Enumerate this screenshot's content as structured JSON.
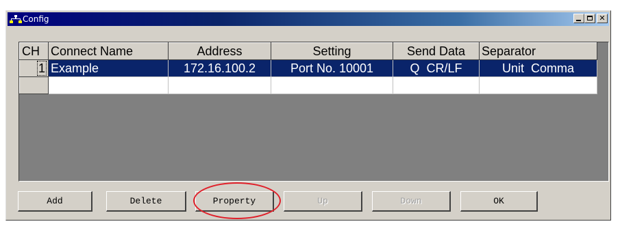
{
  "window": {
    "title": "Config",
    "icon": "network-icon",
    "controls": [
      "minimize-icon",
      "maximize-icon",
      "close-icon"
    ]
  },
  "table": {
    "columns": [
      "CH",
      "Connect Name",
      "Address",
      "Setting",
      "Send Data",
      "Separator"
    ],
    "rows": [
      {
        "ch": "1",
        "connect_name": "Example",
        "address": "172.16.100.2",
        "setting": "Port No. 10001",
        "send_data": "Q  CR/LF",
        "separator": "Unit  Comma",
        "selected": true
      },
      {
        "ch": "",
        "connect_name": "",
        "address": "",
        "setting": "",
        "send_data": "",
        "separator": "",
        "selected": false
      }
    ]
  },
  "buttons": {
    "add": "Add",
    "delete": "Delete",
    "property": "Property",
    "up": "Up",
    "down": "Down",
    "ok": "OK"
  },
  "disabled_buttons": [
    "Up",
    "Down"
  ],
  "colors": {
    "selection": "#0a246a",
    "annotation": "#e0202a",
    "face": "#d4d0c8"
  }
}
